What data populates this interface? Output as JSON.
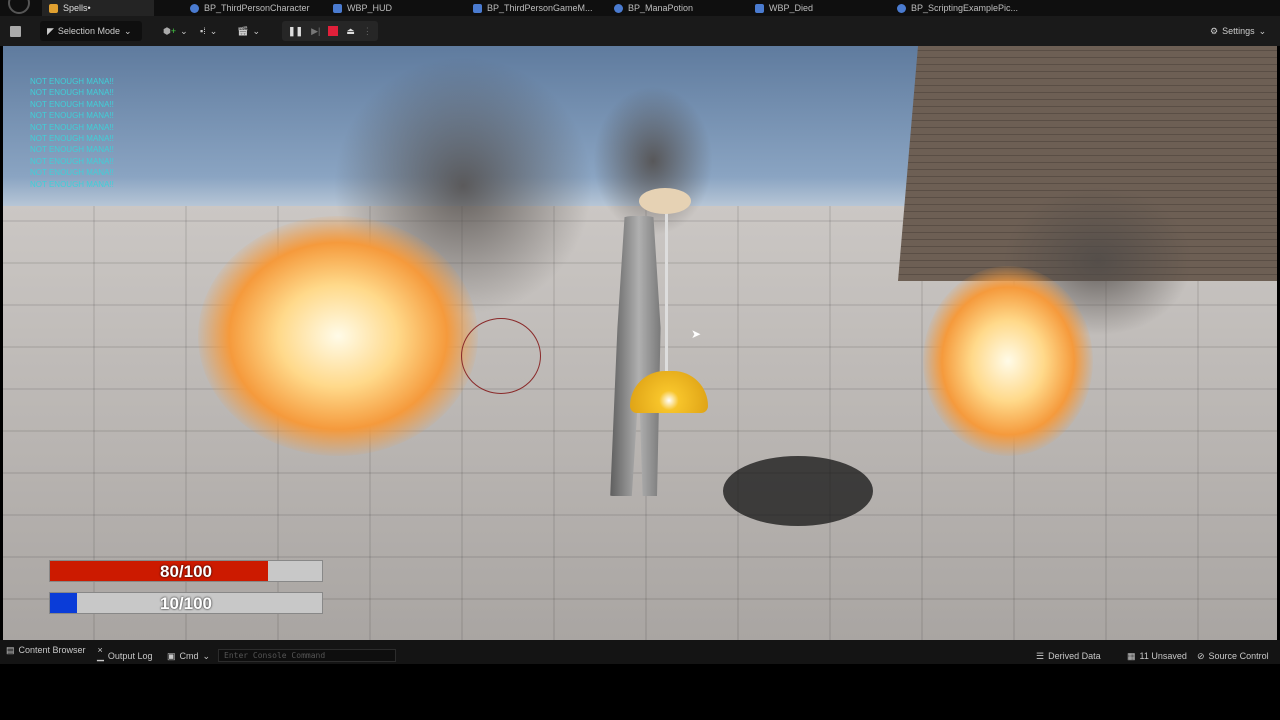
{
  "tabs": [
    {
      "label": "Spells•",
      "active": true,
      "color": "#e0a030"
    },
    {
      "label": "BP_ThirdPersonCharacter",
      "color": "#4a7bd0"
    },
    {
      "label": "WBP_HUD",
      "color": "#4a7bd0"
    },
    {
      "label": "BP_ThirdPersonGameM...",
      "color": "#4a7bd0"
    },
    {
      "label": "BP_ManaPotion",
      "color": "#4a7bd0"
    },
    {
      "label": "WBP_Died",
      "color": "#4a7bd0"
    },
    {
      "label": "BP_ScriptingExamplePic...",
      "color": "#4a7bd0"
    }
  ],
  "toolbar": {
    "selection_mode": "Selection Mode",
    "settings": "Settings"
  },
  "debug_messages": [
    "NOT ENOUGH MANA!!",
    "NOT ENOUGH MANA!!",
    "NOT ENOUGH MANA!!",
    "NOT ENOUGH MANA!!",
    "NOT ENOUGH MANA!!",
    "NOT ENOUGH MANA!!",
    "NOT ENOUGH MANA!!",
    "NOT ENOUGH MANA!!",
    "NOT ENOUGH MANA!!",
    "NOT ENOUGH MANA!!"
  ],
  "hud": {
    "health": {
      "label": "80/100",
      "fraction": 0.8,
      "color": "#cc1a00"
    },
    "mana": {
      "label": "10/100",
      "fraction": 0.1,
      "color": "#0a3cd8"
    }
  },
  "statusbar": {
    "content_browser": "Content Browser",
    "output_log": "Output Log",
    "cmd": "Cmd",
    "console_placeholder": "Enter Console Command",
    "derived_data": "Derived Data",
    "unsaved": "11 Unsaved",
    "source_control": "Source Control"
  }
}
